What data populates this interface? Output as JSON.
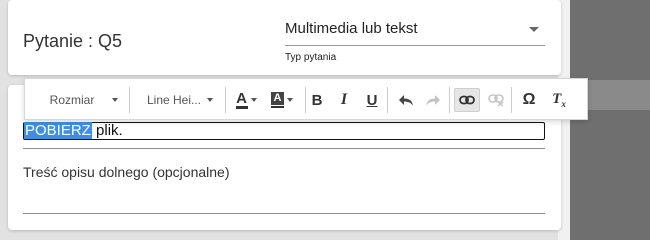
{
  "question": {
    "title": "Pytanie : Q5",
    "type_value": "Multimedia lub tekst",
    "type_label": "Typ pytania"
  },
  "toolbar": {
    "font_size": "Rozmiar",
    "line_height": "Line Hei...",
    "text_color_letter": "A",
    "bg_color_letter": "A",
    "bold": "B",
    "italic": "I",
    "underline": "U",
    "special_char": "Ω",
    "clear_format": "T",
    "clear_format_sub": "x"
  },
  "editor": {
    "selected_text": "POBIERZ",
    "rest_text": " plik."
  },
  "caption": {
    "placeholder": "Treść opisu dolnego (opcjonalne)"
  },
  "colors": {
    "selection": "#3f8ee4",
    "sidebar": "#6f6f6f"
  },
  "icons": [
    "undo-icon",
    "redo-icon",
    "link-icon",
    "unlink-icon",
    "special-char-icon",
    "clear-format-icon"
  ]
}
